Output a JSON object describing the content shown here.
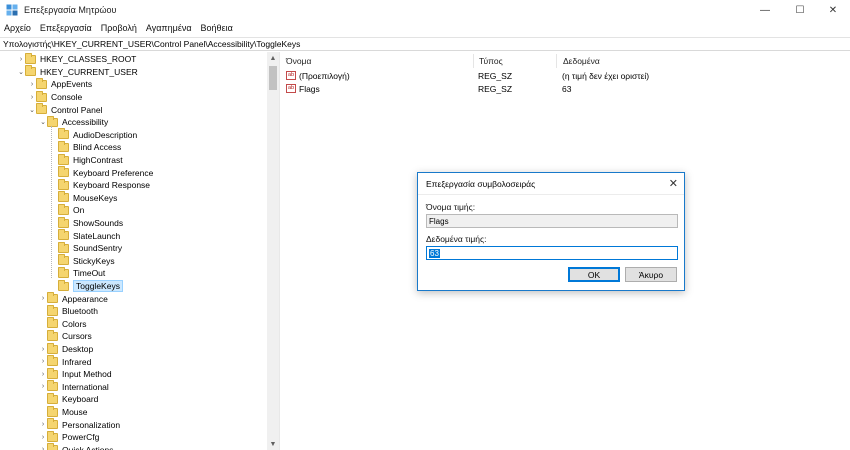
{
  "window": {
    "title": "Επεξεργασία Μητρώου",
    "minimize_glyph": "—",
    "maximize_glyph": "☐",
    "close_glyph": "✕"
  },
  "menu": [
    "Αρχείο",
    "Επεξεργασία",
    "Προβολή",
    "Αγαπημένα",
    "Βοήθεια"
  ],
  "address": "Υπολογιστής\\HKEY_CURRENT_USER\\Control Panel\\Accessibility\\ToggleKeys",
  "tree": [
    {
      "label": "HKEY_CLASSES_ROOT",
      "level": 0,
      "chevron": "›"
    },
    {
      "label": "HKEY_CURRENT_USER",
      "level": 0,
      "chevron": "⌄"
    },
    {
      "label": "AppEvents",
      "level": 1,
      "chevron": "›"
    },
    {
      "label": "Console",
      "level": 1,
      "chevron": "›"
    },
    {
      "label": "Control Panel",
      "level": 1,
      "chevron": "⌄"
    },
    {
      "label": "Accessibility",
      "level": 2,
      "chevron": "⌄"
    },
    {
      "label": "AudioDescription",
      "level": 3,
      "chevron": ""
    },
    {
      "label": "Blind Access",
      "level": 3,
      "chevron": ""
    },
    {
      "label": "HighContrast",
      "level": 3,
      "chevron": ""
    },
    {
      "label": "Keyboard Preference",
      "level": 3,
      "chevron": ""
    },
    {
      "label": "Keyboard Response",
      "level": 3,
      "chevron": ""
    },
    {
      "label": "MouseKeys",
      "level": 3,
      "chevron": ""
    },
    {
      "label": "On",
      "level": 3,
      "chevron": ""
    },
    {
      "label": "ShowSounds",
      "level": 3,
      "chevron": ""
    },
    {
      "label": "SlateLaunch",
      "level": 3,
      "chevron": ""
    },
    {
      "label": "SoundSentry",
      "level": 3,
      "chevron": ""
    },
    {
      "label": "StickyKeys",
      "level": 3,
      "chevron": ""
    },
    {
      "label": "TimeOut",
      "level": 3,
      "chevron": ""
    },
    {
      "label": "ToggleKeys",
      "level": 3,
      "chevron": "",
      "selected": true
    },
    {
      "label": "Appearance",
      "level": 2,
      "chevron": "›"
    },
    {
      "label": "Bluetooth",
      "level": 2,
      "chevron": ""
    },
    {
      "label": "Colors",
      "level": 2,
      "chevron": ""
    },
    {
      "label": "Cursors",
      "level": 2,
      "chevron": ""
    },
    {
      "label": "Desktop",
      "level": 2,
      "chevron": "›"
    },
    {
      "label": "Infrared",
      "level": 2,
      "chevron": "›"
    },
    {
      "label": "Input Method",
      "level": 2,
      "chevron": "›"
    },
    {
      "label": "International",
      "level": 2,
      "chevron": "›"
    },
    {
      "label": "Keyboard",
      "level": 2,
      "chevron": ""
    },
    {
      "label": "Mouse",
      "level": 2,
      "chevron": ""
    },
    {
      "label": "Personalization",
      "level": 2,
      "chevron": "›"
    },
    {
      "label": "PowerCfg",
      "level": 2,
      "chevron": "›"
    },
    {
      "label": "Quick Actions",
      "level": 2,
      "chevron": "›"
    }
  ],
  "columns": {
    "name": "Όνομα",
    "type": "Τύπος",
    "data": "Δεδομένα"
  },
  "values": [
    {
      "icon_text": "ab",
      "name": "(Προεπιλογή)",
      "type": "REG_SZ",
      "data": "(η τιμή δεν έχει οριστεί)"
    },
    {
      "icon_text": "ab",
      "name": "Flags",
      "type": "REG_SZ",
      "data": "63"
    }
  ],
  "dialog": {
    "title": "Επεξεργασία συμβολοσειράς",
    "close_glyph": "✕",
    "value_name_label": "Όνομα τιμής:",
    "value_name": "Flags",
    "value_data_label": "Δεδομένα τιμής:",
    "value_data": "63",
    "ok_label": "OK",
    "cancel_label": "Άκυρο"
  },
  "colors": {
    "accent": "#0078d7",
    "folder": "#f5d56f",
    "selection": "#cce8ff"
  }
}
